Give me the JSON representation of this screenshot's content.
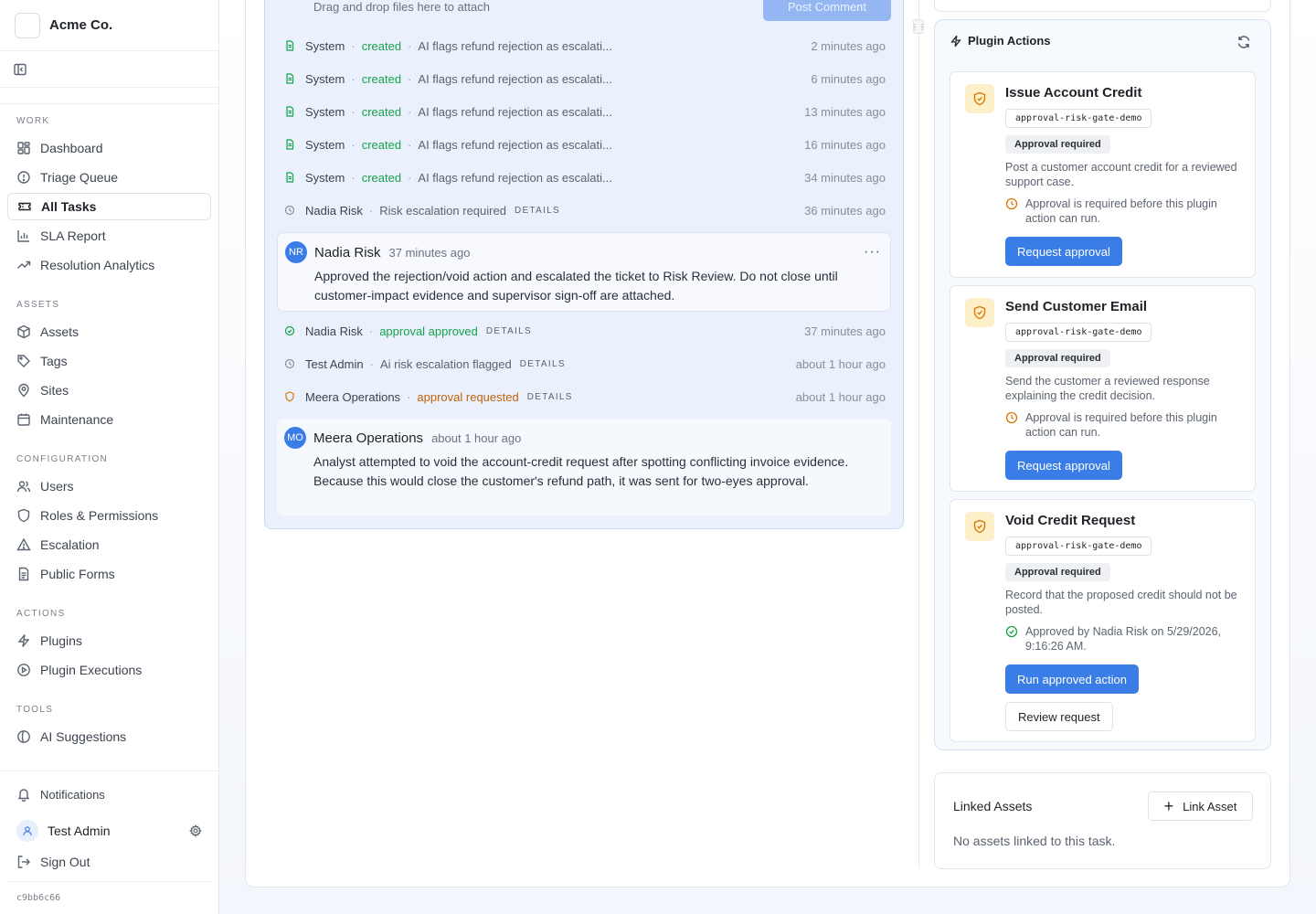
{
  "brand": {
    "name": "Acme Co."
  },
  "sidebar": {
    "sections": [
      {
        "label": "WORK",
        "items": [
          {
            "label": "Dashboard",
            "icon": "dashboard-icon"
          },
          {
            "label": "Triage Queue",
            "icon": "alert-circle-icon"
          },
          {
            "label": "All Tasks",
            "icon": "ticket-icon",
            "active": true
          },
          {
            "label": "SLA Report",
            "icon": "bar-chart-icon"
          },
          {
            "label": "Resolution Analytics",
            "icon": "trending-up-icon"
          }
        ]
      },
      {
        "label": "ASSETS",
        "items": [
          {
            "label": "Assets",
            "icon": "box-icon"
          },
          {
            "label": "Tags",
            "icon": "tag-icon"
          },
          {
            "label": "Sites",
            "icon": "map-pin-icon"
          },
          {
            "label": "Maintenance",
            "icon": "calendar-icon"
          }
        ]
      },
      {
        "label": "CONFIGURATION",
        "items": [
          {
            "label": "Users",
            "icon": "users-icon"
          },
          {
            "label": "Roles & Permissions",
            "icon": "shield-icon"
          },
          {
            "label": "Escalation",
            "icon": "warning-triangle-icon"
          },
          {
            "label": "Public Forms",
            "icon": "file-text-icon"
          }
        ]
      },
      {
        "label": "ACTIONS",
        "items": [
          {
            "label": "Plugins",
            "icon": "zap-icon"
          },
          {
            "label": "Plugin Executions",
            "icon": "play-circle-icon"
          }
        ]
      },
      {
        "label": "TOOLS",
        "items": [
          {
            "label": "AI Suggestions",
            "icon": "sparkle-icon"
          }
        ]
      }
    ],
    "notifications": "Notifications",
    "user": "Test Admin",
    "sign_out": "Sign Out",
    "version": "c9bb6c66"
  },
  "activity": {
    "drop_hint": "Drag and drop files here to attach",
    "post_button": "Post Comment",
    "events": [
      {
        "actor": "System",
        "action": "created",
        "desc": "AI flags refund rejection as escalati...",
        "time": "2 minutes ago"
      },
      {
        "actor": "System",
        "action": "created",
        "desc": "AI flags refund rejection as escalati...",
        "time": "6 minutes ago"
      },
      {
        "actor": "System",
        "action": "created",
        "desc": "AI flags refund rejection as escalati...",
        "time": "13 minutes ago"
      },
      {
        "actor": "System",
        "action": "created",
        "desc": "AI flags refund rejection as escalati...",
        "time": "16 minutes ago"
      },
      {
        "actor": "System",
        "action": "created",
        "desc": "AI flags refund rejection as escalati...",
        "time": "34 minutes ago"
      },
      {
        "actor": "Nadia Risk",
        "desc": "Risk escalation required",
        "details": "DETAILS",
        "time": "36 minutes ago"
      },
      {
        "actor": "Nadia Risk",
        "action": "approval approved",
        "details": "DETAILS",
        "time": "37 minutes ago"
      },
      {
        "actor": "Test Admin",
        "desc": "Ai risk escalation flagged",
        "details": "DETAILS",
        "time": "about 1 hour ago"
      },
      {
        "actor": "Meera Operations",
        "action": "approval requested",
        "details": "DETAILS",
        "time": "about 1 hour ago"
      }
    ],
    "comments": [
      {
        "initials": "NR",
        "name": "Nadia Risk",
        "time": "37 minutes ago",
        "more": "···",
        "body": "Approved the rejection/void action and escalated the ticket to Risk Review. Do not close until customer-impact evidence and supervisor sign-off are attached."
      },
      {
        "initials": "MO",
        "name": "Meera Operations",
        "time": "about 1 hour ago",
        "body": "Analyst attempted to void the account-credit request after spotting conflicting invoice evidence. Because this would close the customer's refund path, it was sent for two-eyes approval."
      }
    ]
  },
  "plugin_actions": {
    "title": "Plugin Actions",
    "cards": [
      {
        "title": "Issue Account Credit",
        "code": "approval-risk-gate-demo",
        "badge": "Approval required",
        "desc": "Post a customer account credit for a reviewed support case.",
        "status": "Approval is required before this plugin action can run.",
        "primary": "Request approval"
      },
      {
        "title": "Send Customer Email",
        "code": "approval-risk-gate-demo",
        "badge": "Approval required",
        "desc": "Send the customer a reviewed response explaining the credit decision.",
        "status": "Approval is required before this plugin action can run.",
        "primary": "Request approval"
      },
      {
        "title": "Void Credit Request",
        "code": "approval-risk-gate-demo",
        "badge": "Approval required",
        "desc": "Record that the proposed credit should not be posted.",
        "status": "Approved by Nadia Risk on 5/29/2026, 9:16:26 AM.",
        "primary": "Run approved action",
        "secondary": "Review request"
      }
    ]
  },
  "linked_assets": {
    "title": "Linked Assets",
    "button": "Link Asset",
    "empty": "No assets linked to this task."
  },
  "colors": {
    "accent": "#3b7de6",
    "success": "#16a34a",
    "warning": "#d97706",
    "created": "#16a34a",
    "requested": "#c2620a"
  }
}
